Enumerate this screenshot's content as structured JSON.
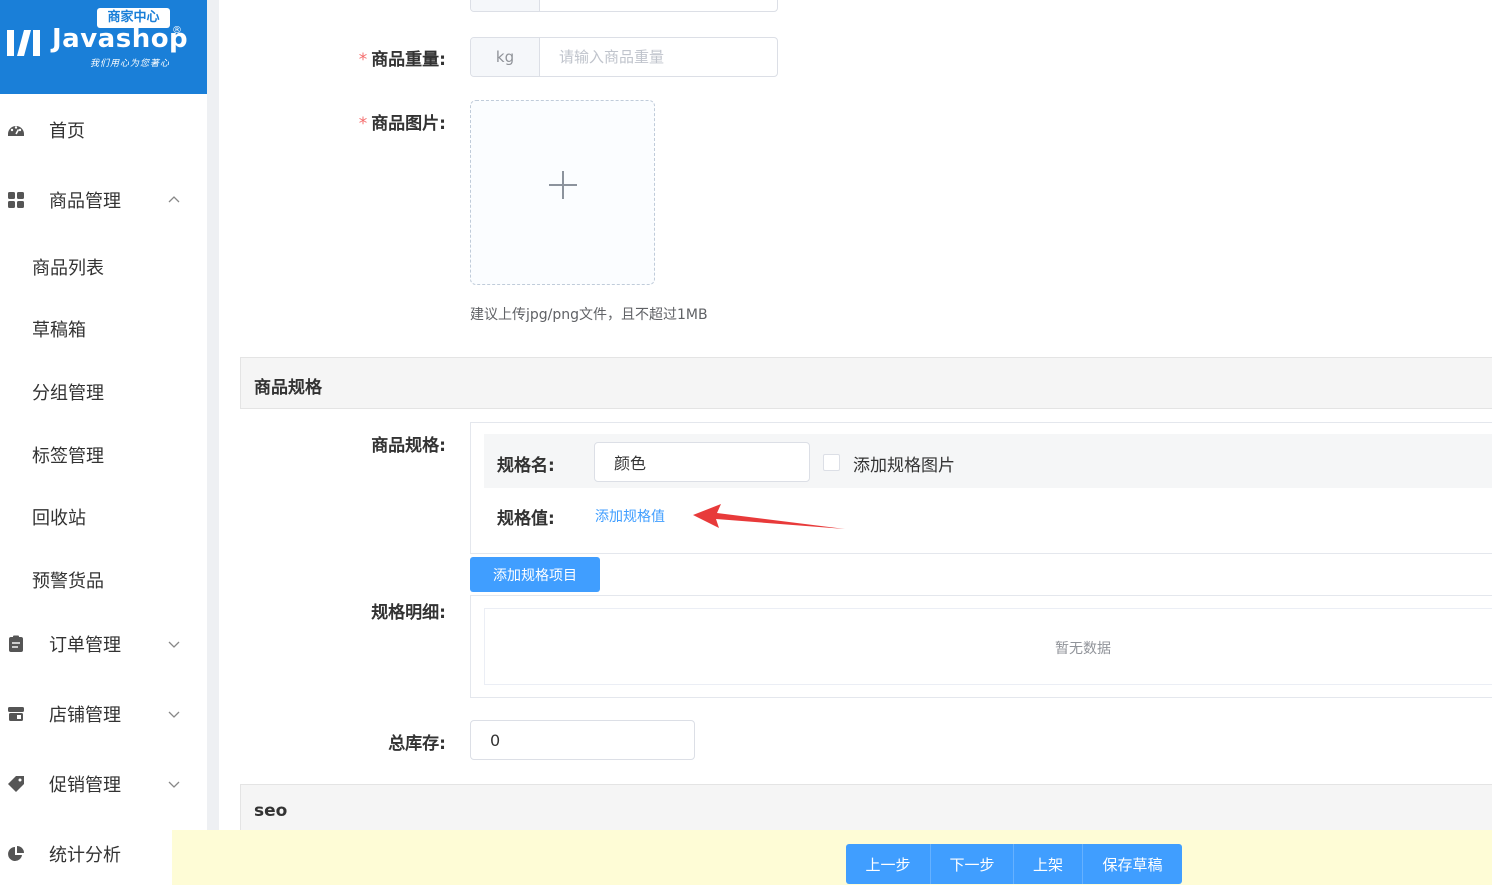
{
  "brand": {
    "badge": "商家中心",
    "name": "Javashop",
    "reg": "®",
    "slogan": "我们用心为您著心"
  },
  "sidebar": {
    "items": [
      {
        "label": "首页",
        "icon": "dashboard-icon"
      },
      {
        "label": "商品管理",
        "icon": "grid-icon",
        "expanded": true
      },
      {
        "label": "订单管理",
        "icon": "clipboard-icon"
      },
      {
        "label": "店铺管理",
        "icon": "store-icon"
      },
      {
        "label": "促销管理",
        "icon": "tag-icon"
      },
      {
        "label": "统计分析",
        "icon": "pie-chart-icon"
      }
    ],
    "sub_items": [
      "商品列表",
      "草稿箱",
      "分组管理",
      "标签管理",
      "回收站",
      "预警货品"
    ]
  },
  "form": {
    "weight": {
      "label": "商品重量:",
      "unit": "kg",
      "placeholder": "请输入商品重量",
      "value": ""
    },
    "image": {
      "label": "商品图片:",
      "hint": "建议上传jpg/png文件，且不超过1MB"
    },
    "spec_section_title": "商品规格",
    "spec": {
      "label": "商品规格:",
      "name_label": "规格名:",
      "name_value": "颜色",
      "add_image_label": "添加规格图片",
      "value_label": "规格值:",
      "add_value_link": "添加规格值",
      "add_item_button": "添加规格项目"
    },
    "detail": {
      "label": "规格明细:",
      "empty": "暂无数据"
    },
    "stock": {
      "label": "总库存:",
      "value": "0"
    },
    "seo_section_title": "seo"
  },
  "actions": [
    "上一步",
    "下一步",
    "上架",
    "保存草稿"
  ],
  "colors": {
    "primary": "#409eff",
    "brand": "#1a7fd8",
    "required": "#f56c6c",
    "arrow": "#e83a3a"
  }
}
